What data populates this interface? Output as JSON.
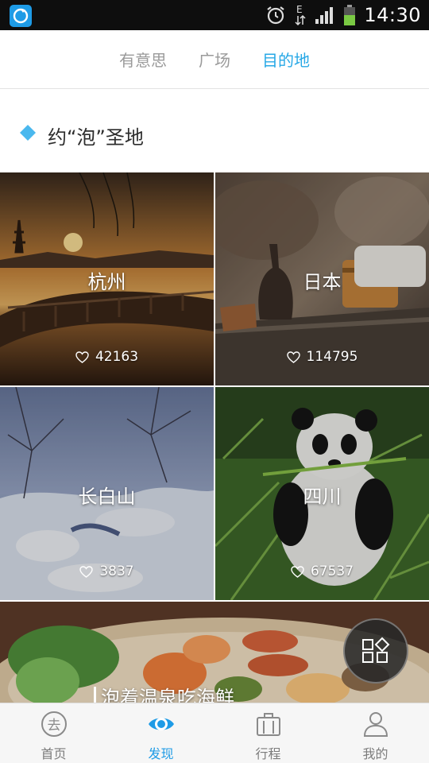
{
  "status_bar": {
    "time": "14:30",
    "network_label": "E",
    "icons": [
      "app-notification-icon",
      "alarm-icon",
      "data-arrows-icon",
      "signal-icon",
      "battery-icon"
    ]
  },
  "top_tabs": [
    {
      "label": "有意思",
      "active": false
    },
    {
      "label": "广场",
      "active": false
    },
    {
      "label": "目的地",
      "active": true
    }
  ],
  "section": {
    "title": "约“泡”圣地"
  },
  "destinations": [
    {
      "name": "杭州",
      "likes": "42163"
    },
    {
      "name": "日本",
      "likes": "114795"
    },
    {
      "name": "长白山",
      "likes": "3837"
    },
    {
      "name": "四川",
      "likes": "67537"
    }
  ],
  "banner": {
    "caption": "泡着温泉吃海鲜"
  },
  "bottom_nav": [
    {
      "label": "首页",
      "icon": "go-icon",
      "active": false
    },
    {
      "label": "发现",
      "icon": "eye-icon",
      "active": true
    },
    {
      "label": "行程",
      "icon": "luggage-icon",
      "active": false
    },
    {
      "label": "我的",
      "icon": "person-icon",
      "active": false
    }
  ],
  "colors": {
    "accent": "#27a8e6",
    "status_bar": "#0e0e0e",
    "battery": "#7ac943"
  }
}
